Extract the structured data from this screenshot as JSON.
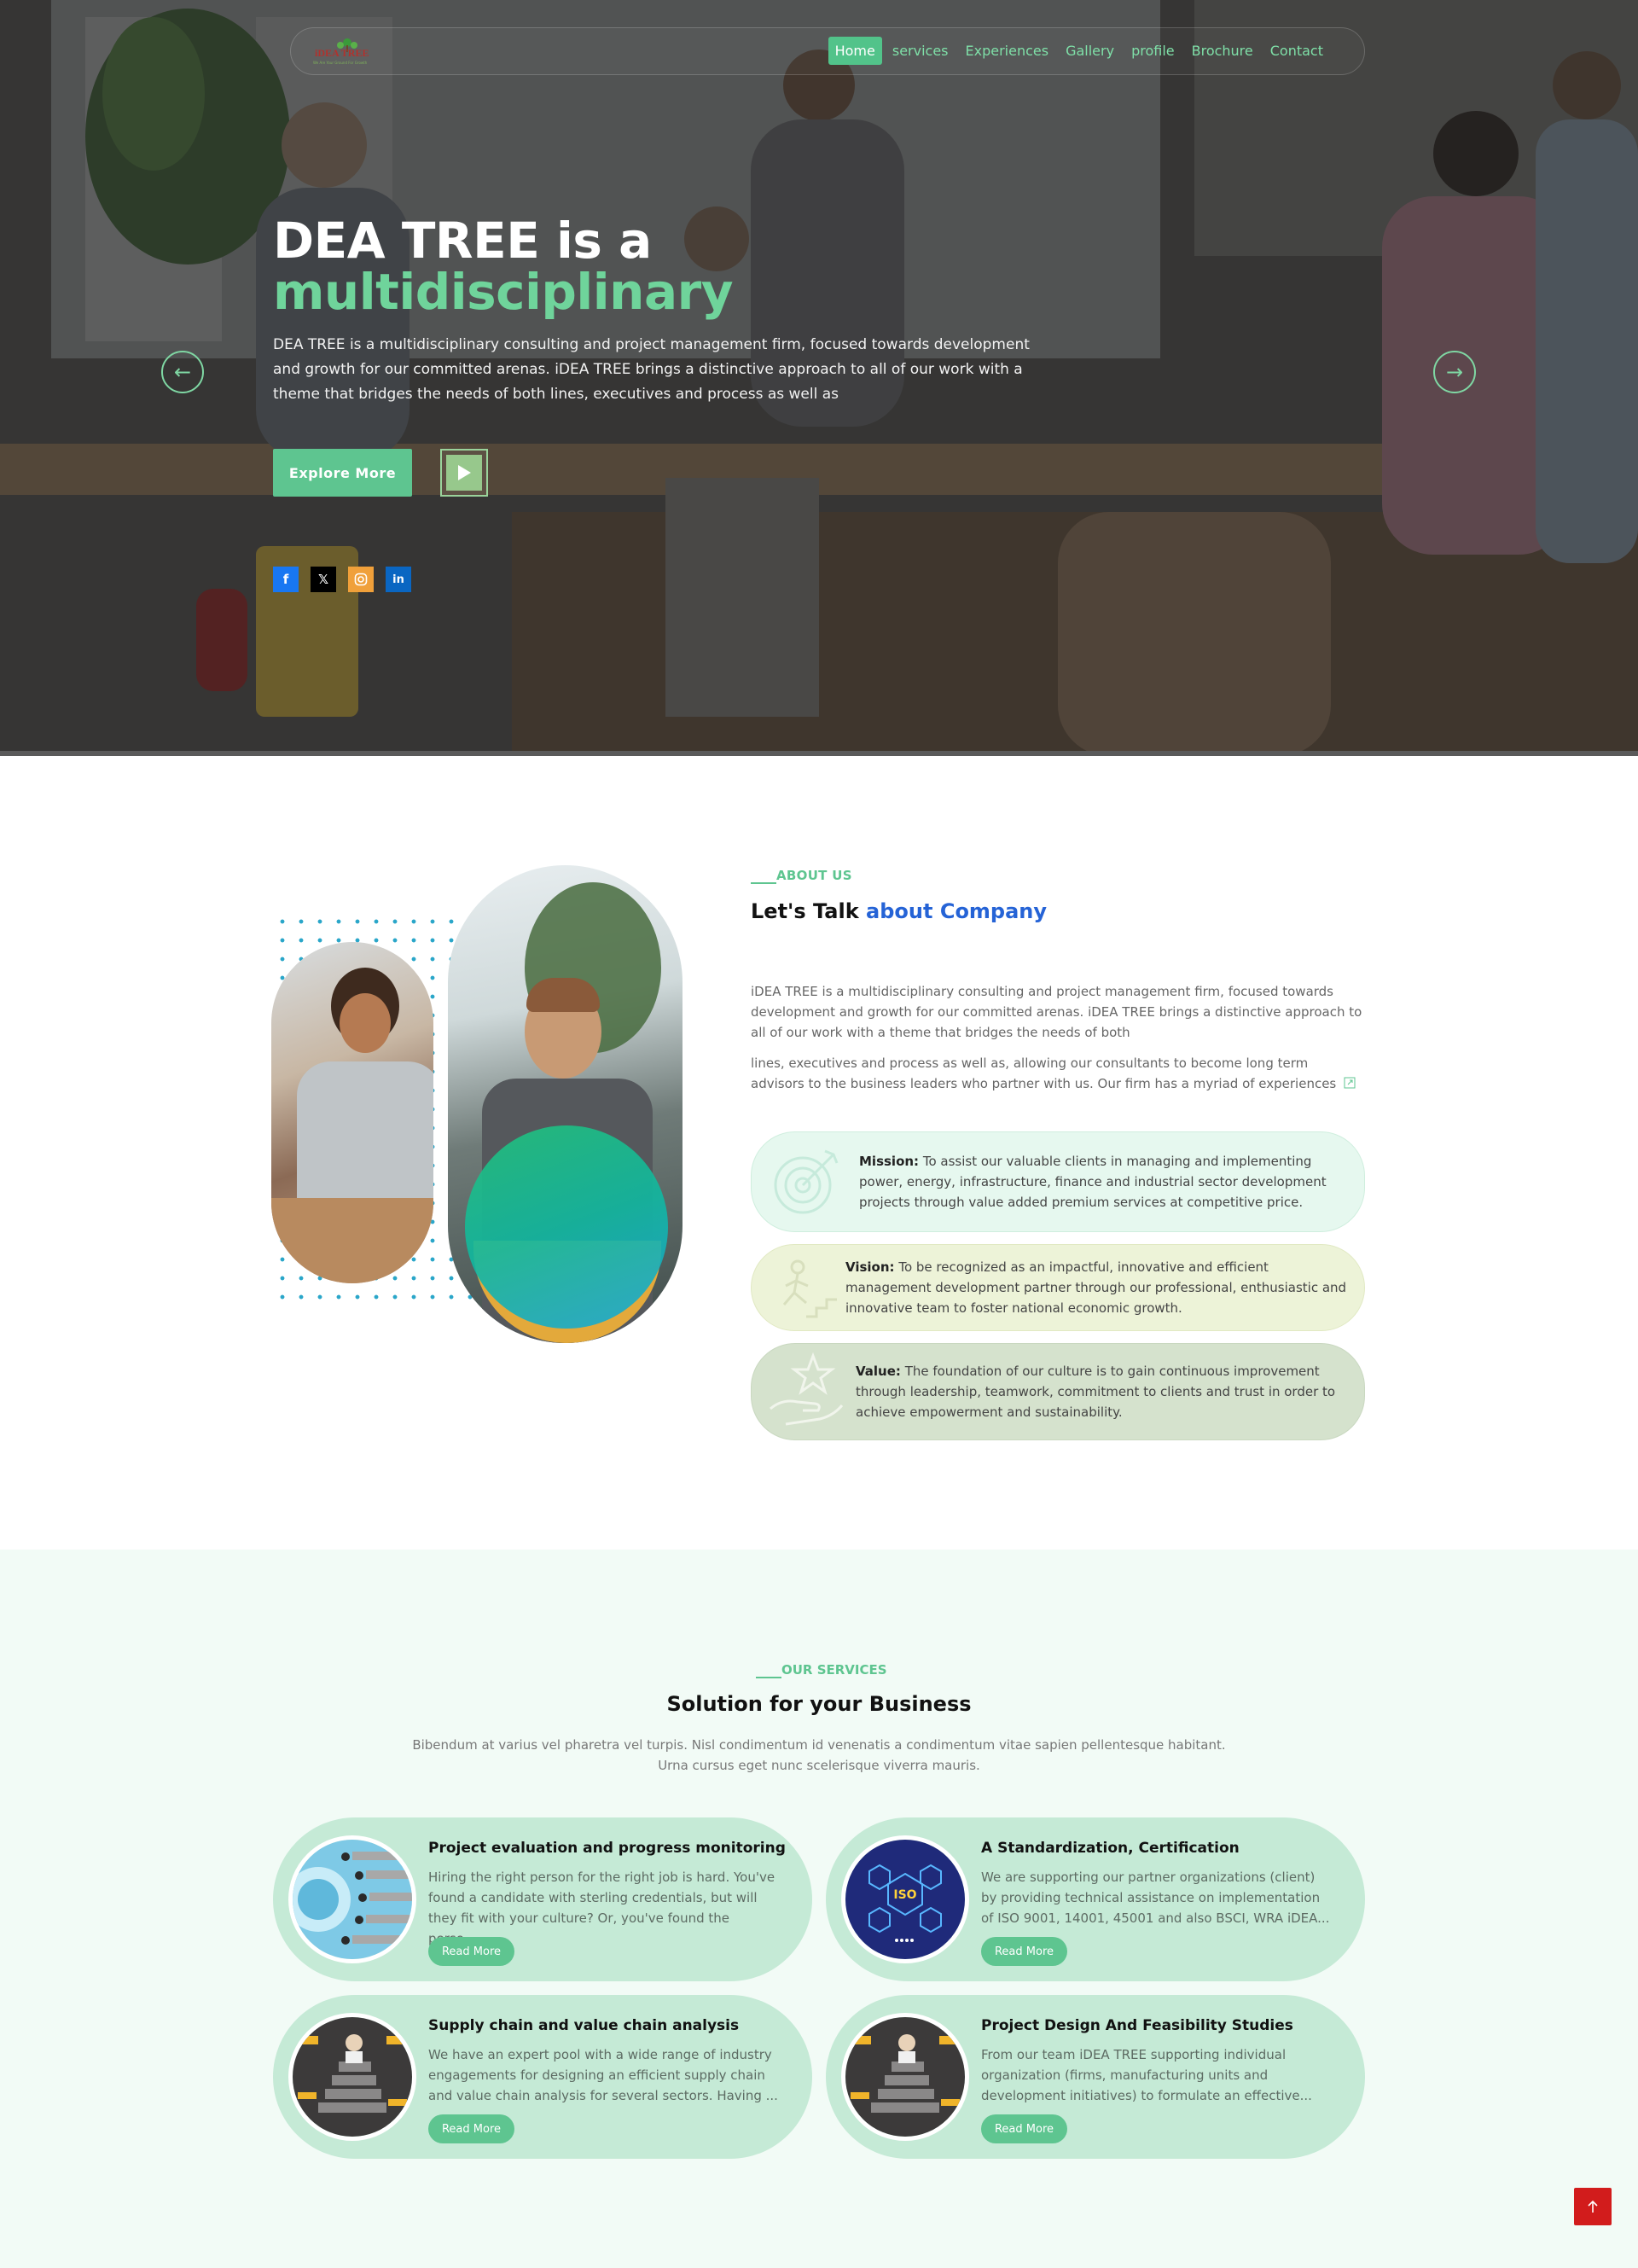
{
  "nav": {
    "logo_text": "iDEA TREE",
    "logo_tagline": "We Are Your Ground For Growth",
    "links": [
      {
        "label": "Home",
        "active": true
      },
      {
        "label": "services",
        "active": false
      },
      {
        "label": "Experiences",
        "active": false
      },
      {
        "label": "Gallery",
        "active": false
      },
      {
        "label": "profile",
        "active": false
      },
      {
        "label": "Brochure",
        "active": false
      },
      {
        "label": "Contact",
        "active": false
      }
    ]
  },
  "hero": {
    "title_line1": "DEA TREE is a",
    "title_line2": "multidisciplinary",
    "description": "DEA TREE is a multidisciplinary consulting and project management firm, focused towards development and growth for our committed arenas. iDEA TREE brings a distinctive approach to all of our work with a theme that bridges the needs of both lines, executives and process as well as",
    "explore_button": "Explore More",
    "play_icon": "play-icon",
    "prev_icon": "arrow-left-icon",
    "next_icon": "arrow-right-icon",
    "social": [
      {
        "name": "facebook-icon",
        "glyph": "f"
      },
      {
        "name": "x-icon",
        "glyph": "X"
      },
      {
        "name": "instagram-icon",
        "glyph": "◎"
      },
      {
        "name": "linkedin-icon",
        "glyph": "in"
      }
    ]
  },
  "about": {
    "label": "ABOUT US",
    "title_plain": "Let's Talk ",
    "title_accent": "about Company",
    "paragraph1": "iDEA TREE is a multidisciplinary consulting and project management firm, focused towards development and growth for our committed arenas. iDEA TREE brings a distinctive approach to all of our work with a theme that bridges the needs of both",
    "paragraph2": "lines, executives and process as well as, allowing our consultants to become long term advisors to the business leaders who partner with us. Our firm has a myriad of experiences",
    "cards": [
      {
        "key": "mission",
        "title": "Mission:",
        "text": "To assist our valuable clients in managing and implementing power, energy, infrastructure, finance and industrial sector development projects through value added premium services at competitive price.",
        "icon": "target-icon"
      },
      {
        "key": "vision",
        "title": "Vision:",
        "text": "To be recognized as an impactful, innovative and efficient management development partner through our professional, enthusiastic and innovative team to foster national economic growth.",
        "icon": "stairs-climber-icon"
      },
      {
        "key": "value",
        "title": "Value:",
        "text": "The foundation of our culture is to gain continuous improvement through leadership, teamwork, commitment to clients and trust in order to achieve empowerment and sustainability.",
        "icon": "star-hand-icon"
      }
    ]
  },
  "services": {
    "label": "OUR SERVICES",
    "title": "Solution for your Business",
    "description_line1": "Bibendum at varius vel pharetra vel turpis. Nisl condimentum id venenatis a condimentum vitae sapien pellentesque habitant.",
    "description_line2": "Urna cursus eget nunc scelerisque viverra mauris.",
    "read_more": "Read More",
    "items": [
      {
        "title": "Project evaluation and progress monitoring",
        "text": "Hiring the right person for the right job is hard. You've found a candidate with sterling credentials, but will they fit with your culture? Or, you've found the perso..."
      },
      {
        "title": "A Standardization, Certification",
        "text": "We are supporting our partner organizations (client) by providing technical assistance on implementation of ISO 9001, 14001, 45001 and also BSCI, WRA iDEA..."
      },
      {
        "title": "Supply chain and value chain analysis",
        "text": "We have an expert pool with a wide range of industry engagements for designing an efficient supply chain and value chain analysis for several sectors. Having ..."
      },
      {
        "title": "Project Design And Feasibility Studies",
        "text": "From our team iDEA TREE supporting individual organization (firms, manufacturing units and development initiatives) to formulate an effective..."
      }
    ]
  },
  "back_to_top_icon": "arrow-up-icon"
}
